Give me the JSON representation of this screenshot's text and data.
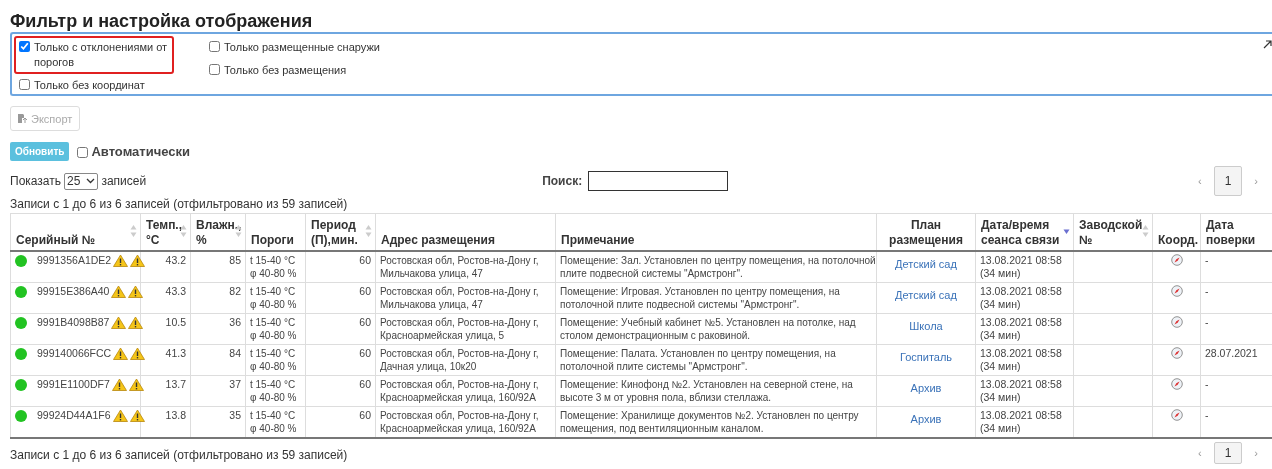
{
  "title": "Фильтр и настройка отображения",
  "filters": [
    {
      "label": "Только с отклонениями от порогов",
      "checked": true,
      "highlighted": true
    },
    {
      "label": "Только без координат",
      "checked": false,
      "highlighted": false
    },
    {
      "label": "Только размещенные снаружи",
      "checked": false,
      "highlighted": false
    },
    {
      "label": "Только без размещения",
      "checked": false,
      "highlighted": false
    }
  ],
  "export_button": {
    "label": "Экспорт",
    "disabled": true
  },
  "refresh_button": "Обновить",
  "auto_refresh": {
    "label": "Автоматически",
    "checked": false
  },
  "page_length": {
    "prefix": "Показать",
    "value": "25",
    "suffix": "записей"
  },
  "search": {
    "label": "Поиск:"
  },
  "pagination": {
    "prev": "‹",
    "page": "1",
    "next": "›"
  },
  "info_top": "Записи с 1 до 6 из 6 записей (отфильтровано из 59 записей)",
  "table": {
    "columns": [
      {
        "label": "Серийный №",
        "kind": "sortable"
      },
      {
        "label": "Темп., °C",
        "kind": "sortable"
      },
      {
        "label": "Влажн., %",
        "kind": "sortable"
      },
      {
        "label": "Пороги",
        "kind": "plain"
      },
      {
        "label": "Период (П),мин.",
        "kind": "sortable"
      },
      {
        "label": "Адрес размещения",
        "kind": "plain"
      },
      {
        "label": "Примечание",
        "kind": "plain"
      },
      {
        "label": "План размещения",
        "kind": "plain"
      },
      {
        "label": "Дата/время сеанса связи",
        "kind": "sorted"
      },
      {
        "label": "Заводской №",
        "kind": "sortable"
      },
      {
        "label": "Коорд.",
        "kind": "plain"
      },
      {
        "label": "Дата поверки",
        "kind": "plain"
      }
    ],
    "rows": [
      {
        "color": "#22c322",
        "serial": "9991356A1DE2",
        "alerts": [
          {
            "kind": "warning"
          },
          {
            "kind": "warning"
          }
        ],
        "temp": "43.2",
        "humidity": "85",
        "thresholds": [
          "t 15-40 °C",
          "φ 40-80 %"
        ],
        "period": "60",
        "address": [
          "Ростовская обл, Ростов-на-Дону г,",
          "Мильчакова улица, 47"
        ],
        "note": [
          "Помещение: Зал. Установлен по центру помещения, на потолочной",
          "плите подвесной системы \"Армстронг\"."
        ],
        "plan": "Детский сад",
        "session": [
          "13.08.2021 08:58",
          "(34 мин)"
        ],
        "verified": "-"
      },
      {
        "color": "#22c322",
        "serial": "99915E386A40",
        "alerts": [
          {
            "kind": "warning"
          },
          {
            "kind": "warning"
          }
        ],
        "temp": "43.3",
        "humidity": "82",
        "thresholds": [
          "t 15-40 °C",
          "φ 40-80 %"
        ],
        "period": "60",
        "address": [
          "Ростовская обл, Ростов-на-Дону г,",
          "Мильчакова улица, 47"
        ],
        "note": [
          "Помещение: Игровая. Установлен по центру помещения, на",
          "потолочной плите подвесной системы \"Армстронг\"."
        ],
        "plan": "Детский сад",
        "session": [
          "13.08.2021 08:58",
          "(34 мин)"
        ],
        "verified": "-"
      },
      {
        "color": "#22c322",
        "serial": "9991B4098B87",
        "alerts": [
          {
            "kind": "warning"
          },
          {
            "kind": "warning"
          }
        ],
        "temp": "10.5",
        "humidity": "36",
        "thresholds": [
          "t 15-40 °C",
          "φ 40-80 %"
        ],
        "period": "60",
        "address": [
          "Ростовская обл, Ростов-на-Дону г,",
          "Красноармейская улица, 5"
        ],
        "note": [
          "Помещение: Учебный кабинет №5. Установлен на потолке, над",
          "столом демонстрационным с раковиной."
        ],
        "plan": "Школа",
        "session": [
          "13.08.2021 08:58",
          "(34 мин)"
        ],
        "verified": "-"
      },
      {
        "color": "#22c322",
        "serial": "999140066FCC",
        "alerts": [
          {
            "kind": "warning"
          },
          {
            "kind": "warning"
          }
        ],
        "temp": "41.3",
        "humidity": "84",
        "thresholds": [
          "t 15-40 °C",
          "φ 40-80 %"
        ],
        "period": "60",
        "address": [
          "Ростовская обл, Ростов-на-Дону г,",
          "Дачная улица, 10к20"
        ],
        "note": [
          "Помещение: Палата. Установлен по центру помещения, на",
          "потолочной плите системы \"Армстронг\"."
        ],
        "plan": "Госпиталь",
        "session": [
          "13.08.2021 08:58",
          "(34 мин)"
        ],
        "verified": "28.07.2021"
      },
      {
        "color": "#22c322",
        "serial": "9991E1100DF7",
        "alerts": [
          {
            "kind": "warning"
          },
          {
            "kind": "warning"
          }
        ],
        "temp": "13.7",
        "humidity": "37",
        "thresholds": [
          "t 15-40 °C",
          "φ 40-80 %"
        ],
        "period": "60",
        "address": [
          "Ростовская обл, Ростов-на-Дону г,",
          "Красноармейская улица, 160/92А"
        ],
        "note": [
          "Помещение: Кинофонд №2. Установлен на северной стене, на",
          "высоте 3 м от уровня пола, вблизи стеллажа."
        ],
        "plan": "Архив",
        "session": [
          "13.08.2021 08:58",
          "(34 мин)"
        ],
        "verified": "-"
      },
      {
        "color": "#22c322",
        "serial": "99924D44A1F6",
        "alerts": [
          {
            "kind": "warning"
          },
          {
            "kind": "warning"
          }
        ],
        "temp": "13.8",
        "humidity": "35",
        "thresholds": [
          "t 15-40 °C",
          "φ 40-80 %"
        ],
        "period": "60",
        "address": [
          "Ростовская обл, Ростов-на-Дону г,",
          "Красноармейская улица, 160/92А"
        ],
        "note": [
          "Помещение: Хранилище документов №2. Установлен по центру",
          "помещения, под вентиляционным каналом."
        ],
        "plan": "Архив",
        "session": [
          "13.08.2021 08:58",
          "(34 мин)"
        ],
        "verified": "-"
      }
    ]
  },
  "info_bottom": "Записи с 1 до 6 из 6 записей (отфильтровано из 59 записей)",
  "pagination_bottom": {
    "prev": "‹",
    "page": "1",
    "next": "›"
  }
}
